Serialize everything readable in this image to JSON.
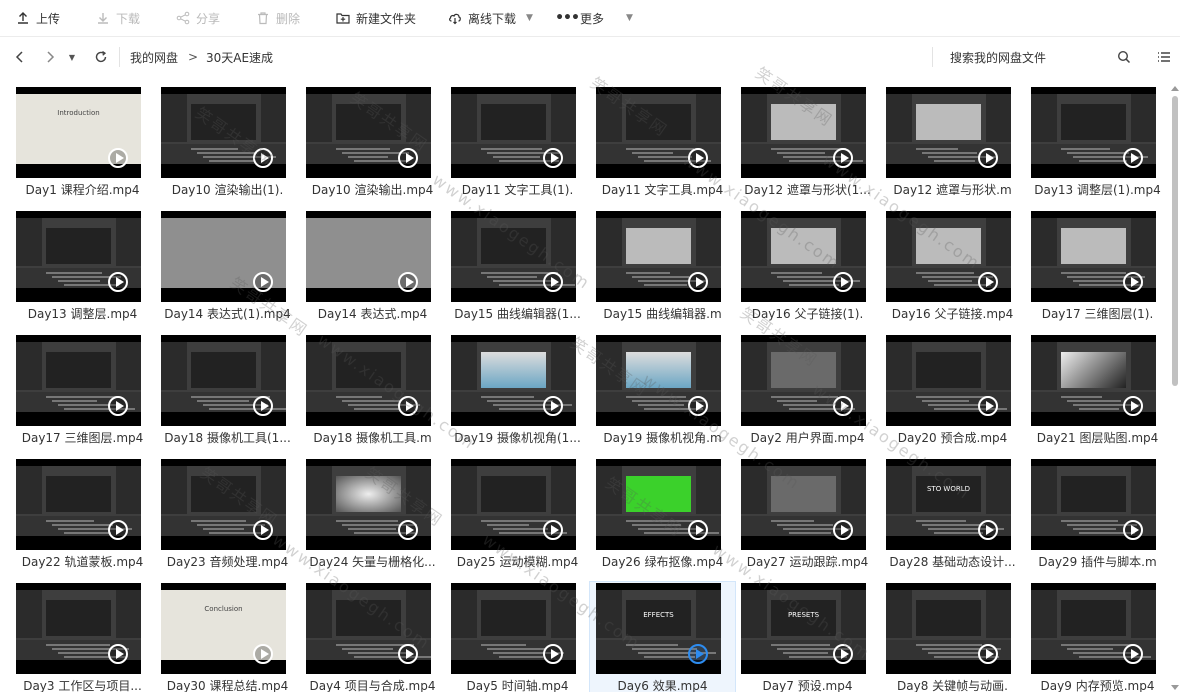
{
  "toolbar": {
    "upload": "上传",
    "download": "下载",
    "share": "分享",
    "delete": "删除",
    "new_folder": "新建文件夹",
    "offline_download": "离线下载",
    "more": "更多"
  },
  "nav": {
    "breadcrumbs": [
      "我的网盘",
      "30天AE速成"
    ],
    "separator": ">",
    "search_placeholder": "搜索我的网盘文件"
  },
  "watermark": {
    "cn": "笑哥共享网",
    "url": "www.xiaogegh.com"
  },
  "files": [
    "Day1 课程介绍.mp4",
    "Day10 渲染输出(1).",
    "Day10 渲染输出.mp4",
    "Day11 文字工具(1).",
    "Day11 文字工具.mp4",
    "Day12 遮罩与形状(1...",
    "Day12 遮罩与形状.m",
    "Day13 调整层(1).mp4",
    "Day13 调整层.mp4",
    "Day14 表达式(1).mp4",
    "Day14 表达式.mp4",
    "Day15 曲线编辑器(1...",
    "Day15 曲线编辑器.m",
    "Day16 父子链接(1).",
    "Day16 父子链接.mp4",
    "Day17 三维图层(1).",
    "Day17 三维图层.mp4",
    "Day18 摄像机工具(1...",
    "Day18 摄像机工具.m",
    "Day19 摄像机视角(1...",
    "Day19 摄像机视角.m",
    "Day2 用户界面.mp4",
    "Day20 预合成.mp4",
    "Day21 图层贴图.mp4",
    "Day22 轨道蒙板.mp4",
    "Day23 音频处理.mp4",
    "Day24 矢量与栅格化...",
    "Day25 运动模糊.mp4",
    "Day26 绿布抠像.mp4",
    "Day27 运动跟踪.mp4",
    "Day28 基础动态设计...",
    "Day29 插件与脚本.m",
    "Day3 工作区与项目...",
    "Day30 课程总结.mp4",
    "Day4 项目与合成.mp4",
    "Day5 时间轴.mp4",
    "Day6 效果.mp4",
    "Day7 预设.mp4",
    "Day8 关键帧与动画.",
    "Day9 内存预览.mp4"
  ],
  "thumb_texts": {
    "intro_title": "Introduction",
    "conclusion_title": "Conclusion",
    "effects_title": "EFFECTS",
    "presets_title": "PRESETS",
    "world_title": "STO WORLD"
  },
  "colors": {
    "accent": "#2d8cf0",
    "green_screen": "#3bd12b",
    "selected_bg": "#eef5fd"
  }
}
